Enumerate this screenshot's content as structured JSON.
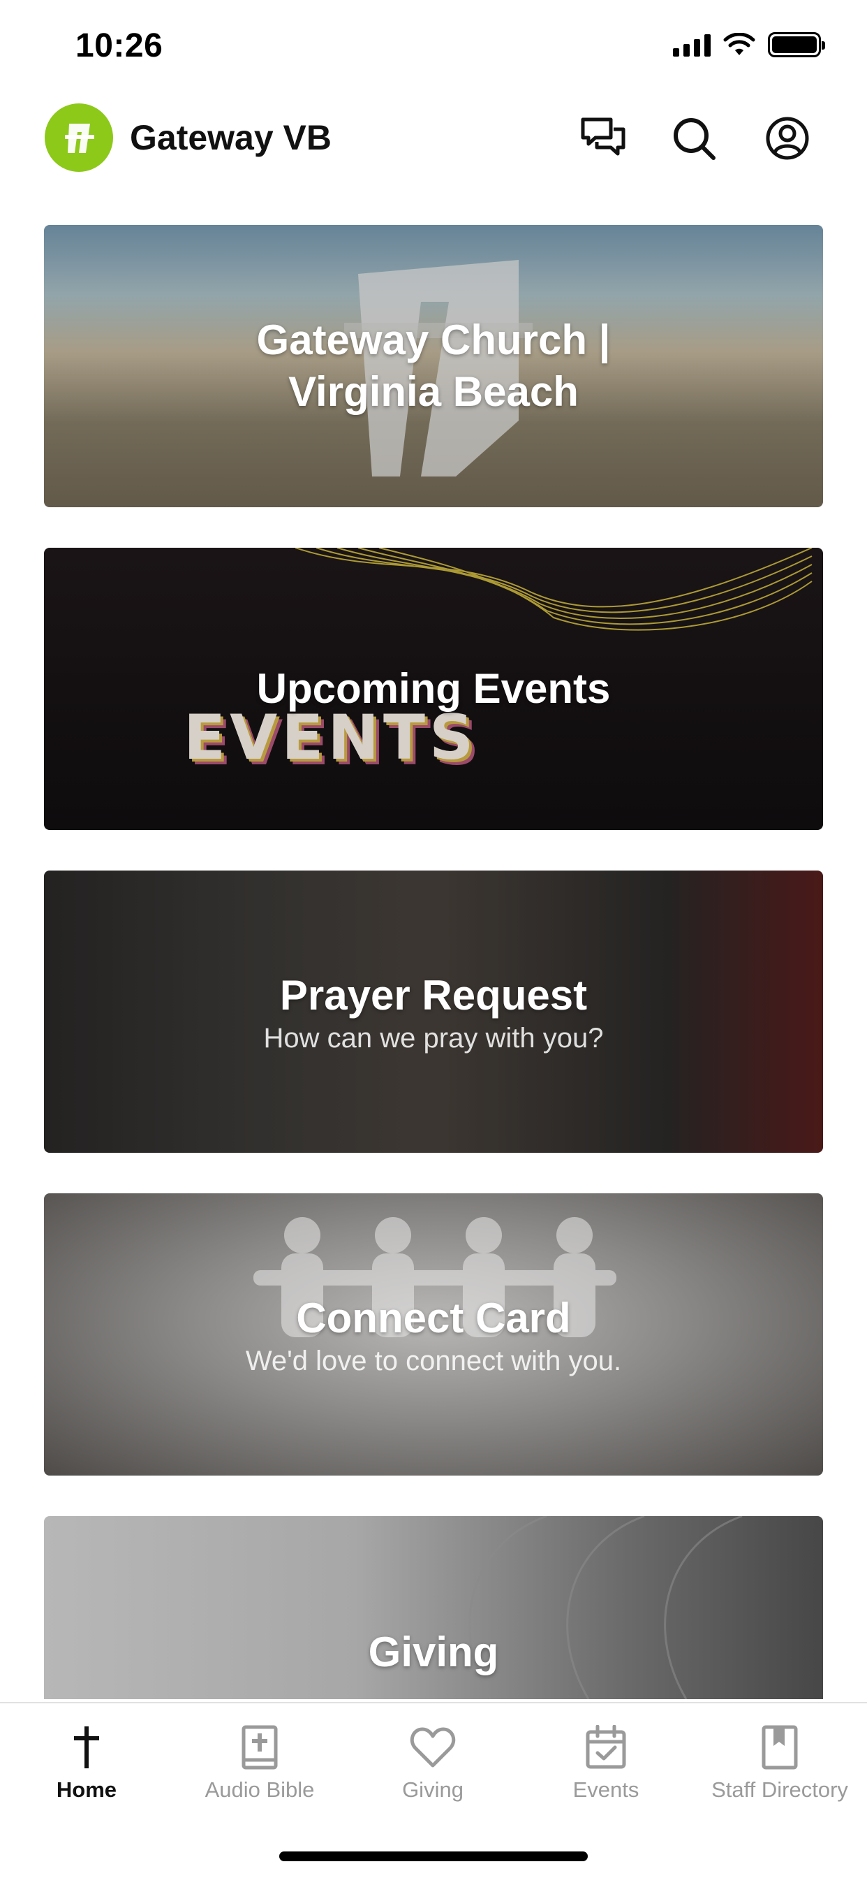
{
  "status_bar": {
    "time": "10:26"
  },
  "header": {
    "brand_name": "Gateway VB",
    "brand_color": "#8cc919",
    "actions": [
      {
        "icon": "chat-icon"
      },
      {
        "icon": "search-icon"
      },
      {
        "icon": "profile-icon"
      }
    ]
  },
  "cards": [
    {
      "title_line1": "Gateway Church |",
      "title_line2": "Virginia Beach",
      "subtitle": ""
    },
    {
      "title": "Upcoming Events",
      "subtitle": "",
      "art_text": "EVENTS"
    },
    {
      "title": "Prayer Request",
      "subtitle": "How can we pray with you?"
    },
    {
      "title": "Connect Card",
      "subtitle": "We'd love to connect with you."
    },
    {
      "title": "Giving",
      "subtitle": ""
    }
  ],
  "tab_bar": {
    "active_index": 0,
    "tabs": [
      {
        "label": "Home",
        "icon": "cross-icon"
      },
      {
        "label": "Audio Bible",
        "icon": "bible-icon"
      },
      {
        "label": "Giving",
        "icon": "heart-icon"
      },
      {
        "label": "Events",
        "icon": "calendar-icon"
      },
      {
        "label": "Staff Directory",
        "icon": "bookmark-book-icon"
      }
    ]
  }
}
